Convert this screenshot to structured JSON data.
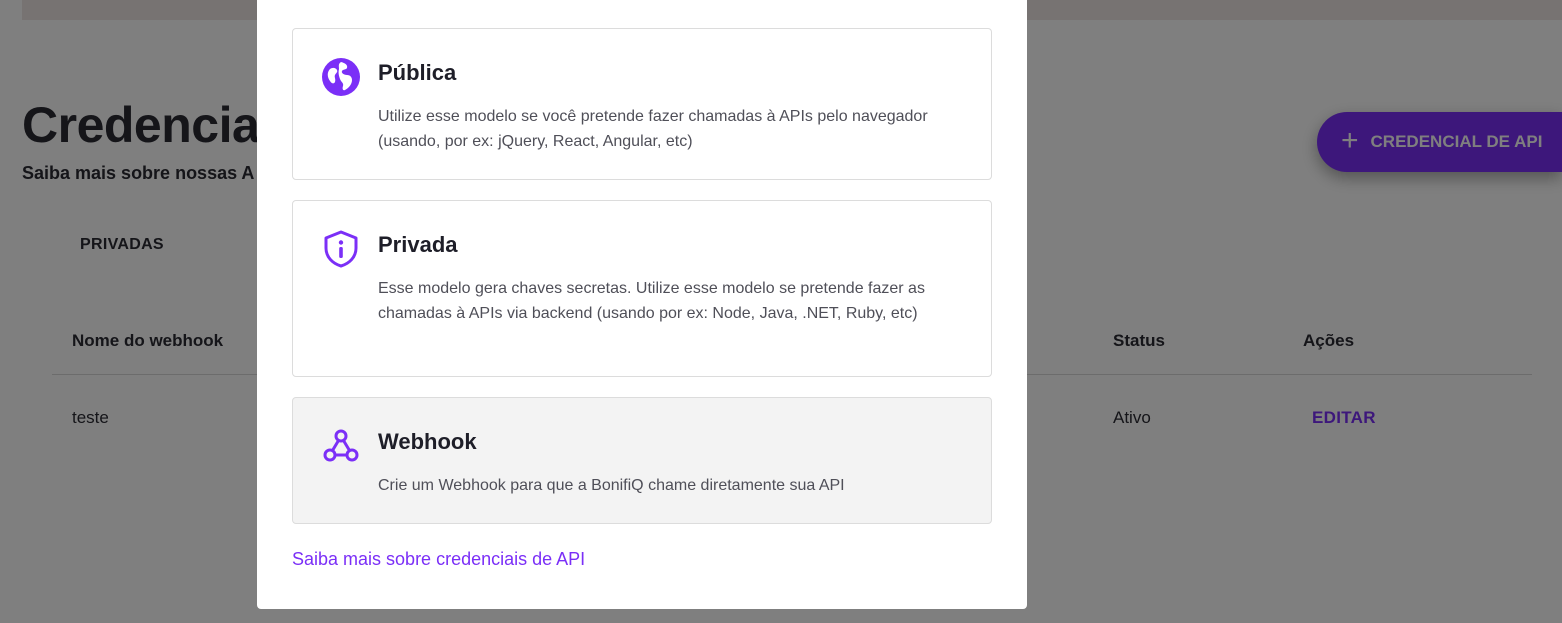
{
  "background": {
    "title": "Credenciai",
    "subtitle": "Saiba mais sobre nossas A",
    "add_button": {
      "icon": "plus-icon",
      "label": "CREDENCIAL DE API"
    },
    "tab": "PRIVADAS",
    "table": {
      "columns": {
        "name": "Nome do webhook",
        "status": "Status",
        "actions": "Ações"
      },
      "rows": [
        {
          "name": "teste",
          "status": "Ativo",
          "action": "EDITAR"
        }
      ]
    }
  },
  "modal": {
    "options": [
      {
        "icon": "globe-icon",
        "title": "Pública",
        "description": "Utilize esse modelo se você pretende fazer chamadas à APIs pelo navegador (usando, por ex: jQuery, React, Angular, etc)"
      },
      {
        "icon": "shield-info-icon",
        "title": "Privada",
        "description": "Esse modelo gera chaves secretas. Utilize esse modelo se pretende fazer as chamadas à APIs via backend (usando por ex: Node, Java, .NET, Ruby, etc)"
      },
      {
        "icon": "webhook-icon",
        "title": "Webhook",
        "description": "Crie um Webhook para que a BonifiQ chame diretamente sua API"
      }
    ],
    "learn_more_link": "Saiba mais sobre credenciais de API"
  },
  "colors": {
    "accent": "#7b2ff7",
    "text": "#2a2a33",
    "overlay": "rgba(0,0,0,0.5)",
    "selected_option_bg": "#f3f3f3"
  }
}
